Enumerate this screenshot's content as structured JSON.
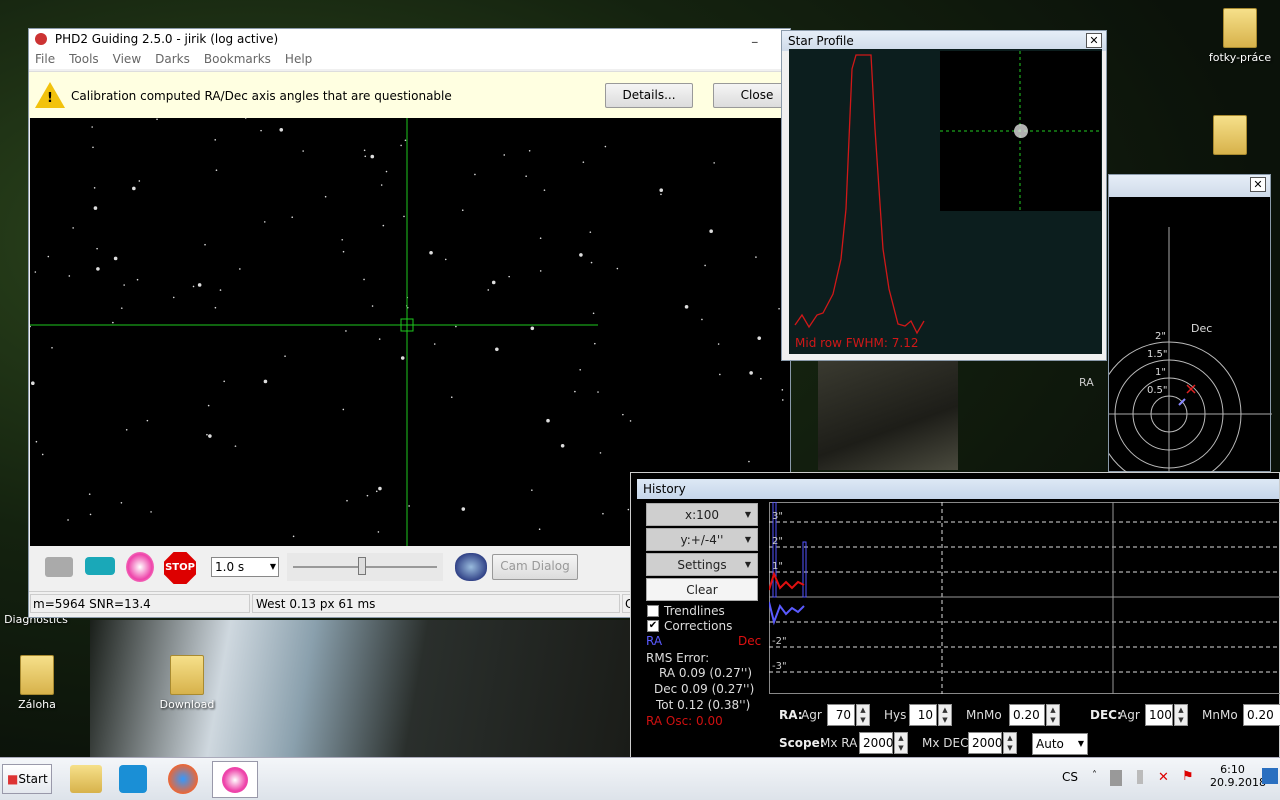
{
  "desktop": {
    "icons": [
      {
        "label": "fotky-práce"
      },
      {
        "label": "Záloha"
      },
      {
        "label": "Download"
      },
      {
        "label": "Diagnostics"
      }
    ]
  },
  "main": {
    "title": "PHD2 Guiding 2.5.0 - jirik (log active)",
    "menu": [
      "File",
      "Tools",
      "View",
      "Darks",
      "Bookmarks",
      "Help"
    ],
    "alert": {
      "text": "Calibration computed RA/Dec axis angles that are questionable",
      "details": "Details...",
      "close": "Close",
      "icon": "warning-icon"
    },
    "toolbar": {
      "exposure": "1.0 s",
      "cam_dialog": "Cam Dialog",
      "exposure_slider": 0.45,
      "icons": [
        "camera-icon",
        "loop-icon",
        "guide-icon",
        "stop-icon",
        "brain-icon"
      ],
      "stop_text": "STOP"
    },
    "status": {
      "star": "m=5964 SNR=13.4",
      "guide": "West  0.13 px  61 ms",
      "extra": "C"
    }
  },
  "star_profile": {
    "title": "Star Profile",
    "fwhm": "Mid row FWHM: 7.12",
    "color": "#d01818"
  },
  "target": {
    "labels": {
      "dec": "Dec",
      "ra": "RA"
    },
    "rings": [
      "0.5\"",
      "1\"",
      "1.5\"",
      "2\""
    ]
  },
  "history": {
    "title": "History",
    "x_scale": "x:100",
    "y_scale": "y:+/-4''",
    "settings": "Settings",
    "clear": "Clear",
    "trendlines": {
      "label": "Trendlines",
      "checked": false
    },
    "corrections": {
      "label": "Corrections",
      "checked": true
    },
    "ra_legend": "RA",
    "dec_legend": "Dec",
    "ra_color": "#5a5aff",
    "dec_color": "#e01010",
    "rms_title": "RMS Error:",
    "rms_ra": "RA 0.09 (0.27'')",
    "rms_dec": "Dec 0.09 (0.27'')",
    "rms_tot": "Tot 0.12 (0.38'')",
    "ra_osc": "RA Osc: 0.00",
    "y_labels": [
      "3\"",
      "2\"",
      "1\"",
      "-2\"",
      "-3\""
    ],
    "ra_ctrl": {
      "label": "RA:",
      "agr_label": "Agr",
      "agr": "70",
      "hys_label": "Hys",
      "hys": "10",
      "mnmo_label": "MnMo",
      "mnmo": "0.20"
    },
    "dec_ctrl": {
      "label": "DEC:",
      "agr_label": "Agr",
      "agr": "100",
      "mnmo_label": "MnMo",
      "mnmo": "0.20"
    },
    "scope": {
      "label": "Scope:",
      "mxra_label": "Mx RA",
      "mxra": "2000",
      "mxdec_label": "Mx DEC",
      "mxdec": "2000",
      "mode": "Auto"
    }
  },
  "taskbar": {
    "start": "Start",
    "lang": "CS",
    "time": "6:10",
    "date": "20.9.2018"
  }
}
